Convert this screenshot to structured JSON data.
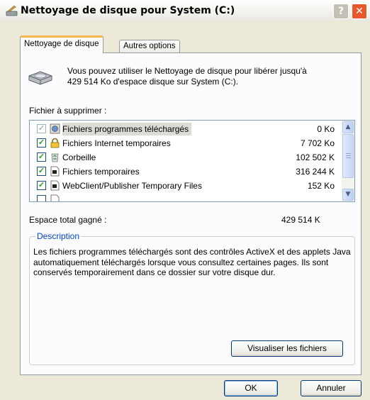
{
  "window": {
    "title": "Nettoyage de disque pour System (C:)",
    "help_label": "?",
    "close_label": "✕"
  },
  "tabs": [
    {
      "label": "Nettoyage de disque",
      "active": true
    },
    {
      "label": "Autres options",
      "active": false
    }
  ],
  "intro": {
    "line1": "Vous pouvez utiliser le Nettoyage de disque pour libérer jusqu'à",
    "line2": "429 514 Ko d'espace disque sur System (C:)."
  },
  "files_label": "Fichier à supprimer :",
  "files": [
    {
      "name": "Fichiers programmes téléchargés",
      "size": "0 Ko",
      "checked": true,
      "selected": true,
      "icon": "downloaded-programs-icon"
    },
    {
      "name": "Fichiers Internet temporaires",
      "size": "7 702 Ko",
      "checked": true,
      "selected": false,
      "icon": "lock-icon"
    },
    {
      "name": "Corbeille",
      "size": "102 502 K",
      "checked": true,
      "selected": false,
      "icon": "recycle-bin-icon"
    },
    {
      "name": "Fichiers temporaires",
      "size": "316 244 K",
      "checked": true,
      "selected": false,
      "icon": "temp-file-icon"
    },
    {
      "name": "WebClient/Publisher Temporary Files",
      "size": "152 Ko",
      "checked": true,
      "selected": false,
      "icon": "temp-file-icon"
    }
  ],
  "total": {
    "label": "Espace total gagné :",
    "value": "429 514 K"
  },
  "description": {
    "legend": "Description",
    "text": "Les fichiers programmes téléchargés sont des contrôles ActiveX et des applets Java automatiquement téléchargés lorsque vous consultez certaines pages. Ils sont conservés temporairement dans ce dossier sur votre disque dur."
  },
  "buttons": {
    "view_files": "Visualiser les fichiers",
    "ok": "OK",
    "cancel": "Annuler"
  },
  "colors": {
    "check": "#21a121",
    "legend": "#0046d5",
    "close": "#e8562c",
    "tab_highlight": "#f7b34f"
  }
}
